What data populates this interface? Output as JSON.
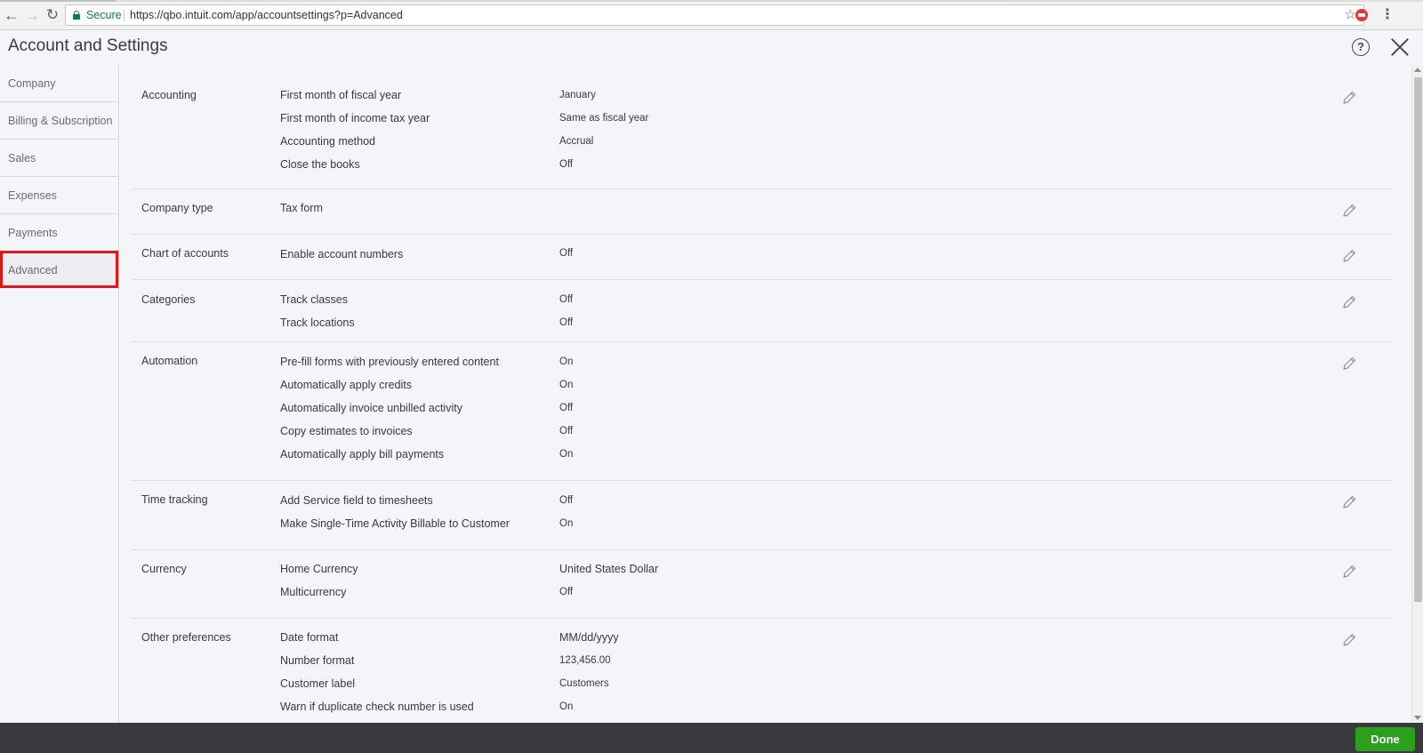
{
  "browser": {
    "secure_label": "Secure",
    "url": "https://qbo.intuit.com/app/accountsettings?p=Advanced",
    "icons": {
      "back": "arrow-left-icon",
      "forward": "arrow-right-icon",
      "reload": "reload-icon",
      "lock": "lock-icon",
      "star": "star-icon",
      "extension": "extension-icon",
      "menu": "kebab-menu-icon"
    }
  },
  "header": {
    "title": "Account and Settings",
    "icons": {
      "help": "help-icon",
      "close": "close-icon"
    }
  },
  "sidebar": {
    "items": [
      {
        "label": "Company"
      },
      {
        "label": "Billing & Subscription"
      },
      {
        "label": "Sales"
      },
      {
        "label": "Expenses"
      },
      {
        "label": "Payments"
      },
      {
        "label": "Advanced",
        "active": true
      }
    ],
    "highlight_color": "#e1151a"
  },
  "sections": [
    {
      "title": "Accounting",
      "rows": [
        {
          "label": "First month of fiscal year",
          "value": "January"
        },
        {
          "label": "First month of income tax year",
          "value": "Same as fiscal year"
        },
        {
          "label": "Accounting method",
          "value": "Accrual"
        },
        {
          "label": "Close the books",
          "value": "Off"
        }
      ]
    },
    {
      "title": "Company type",
      "rows": [
        {
          "label": "Tax form",
          "value": ""
        }
      ]
    },
    {
      "title": "Chart of accounts",
      "rows": [
        {
          "label": "Enable account numbers",
          "value": "Off"
        }
      ]
    },
    {
      "title": "Categories",
      "rows": [
        {
          "label": "Track classes",
          "value": "Off"
        },
        {
          "label": "Track locations",
          "value": "Off"
        }
      ]
    },
    {
      "title": "Automation",
      "rows": [
        {
          "label": "Pre-fill forms with previously entered content",
          "value": "On"
        },
        {
          "label": "Automatically apply credits",
          "value": "On"
        },
        {
          "label": "Automatically invoice unbilled activity",
          "value": "Off"
        },
        {
          "label": "Copy estimates to invoices",
          "value": "Off"
        },
        {
          "label": "Automatically apply bill payments",
          "value": "On"
        }
      ]
    },
    {
      "title": "Time tracking",
      "rows": [
        {
          "label": "Add Service field to timesheets",
          "value": "Off"
        },
        {
          "label": "Make Single-Time Activity Billable to Customer",
          "value": "On"
        }
      ]
    },
    {
      "title": "Currency",
      "rows": [
        {
          "label": "Home Currency",
          "value": "United States Dollar"
        },
        {
          "label": "Multicurrency",
          "value": "Off"
        }
      ]
    },
    {
      "title": "Other preferences",
      "rows": [
        {
          "label": "Date format",
          "value": "MM/dd/yyyy"
        },
        {
          "label": "Number format",
          "value": "123,456.00"
        },
        {
          "label": "Customer label",
          "value": "Customers"
        },
        {
          "label": "Warn if duplicate check number is used",
          "value": "On"
        }
      ]
    }
  ],
  "edit_icon": "pencil-icon",
  "footer": {
    "done_label": "Done",
    "done_color": "#2ca01c"
  }
}
